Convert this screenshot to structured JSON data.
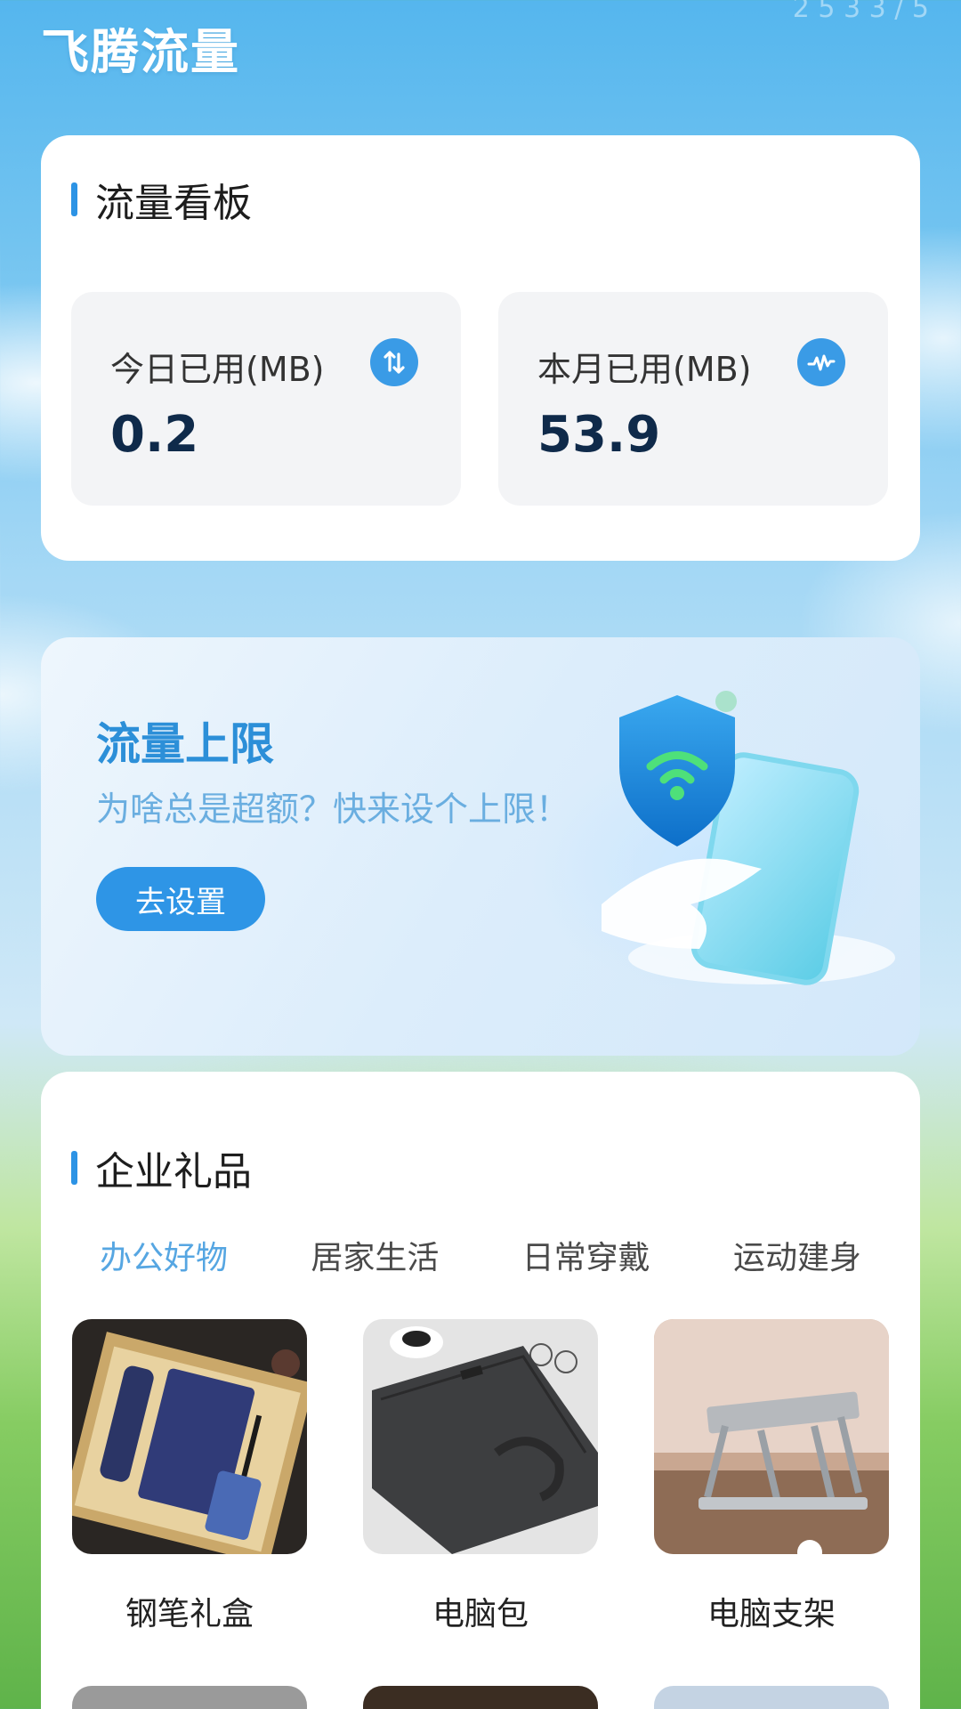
{
  "header": {
    "title": "飞腾流量",
    "status_text": "2 5 3 3 / 5"
  },
  "dashboard": {
    "title": "流量看板",
    "today": {
      "label": "今日已用(MB)",
      "value": "0.2",
      "icon": "up-down-arrows-icon"
    },
    "month": {
      "label": "本月已用(MB)",
      "value": "53.9",
      "icon": "activity-pulse-icon"
    }
  },
  "banner": {
    "title": "流量上限",
    "subtitle": "为啥总是超额？快来设个上限！",
    "button_label": "去设置",
    "illustration": "shield-phone-illustration"
  },
  "gifts": {
    "title": "企业礼品",
    "tabs": [
      {
        "label": "办公好物",
        "active": true
      },
      {
        "label": "居家生活",
        "active": false
      },
      {
        "label": "日常穿戴",
        "active": false
      },
      {
        "label": "运动建身",
        "active": false
      }
    ],
    "products": [
      {
        "name": "钢笔礼盒",
        "image": "pen-gift-box-image"
      },
      {
        "name": "电脑包",
        "image": "laptop-bag-image"
      },
      {
        "name": "电脑支架",
        "image": "laptop-stand-image"
      }
    ]
  },
  "colors": {
    "accent": "#2c93e5",
    "banner_title": "#2c8fd8",
    "value_text": "#0f2a4a"
  }
}
